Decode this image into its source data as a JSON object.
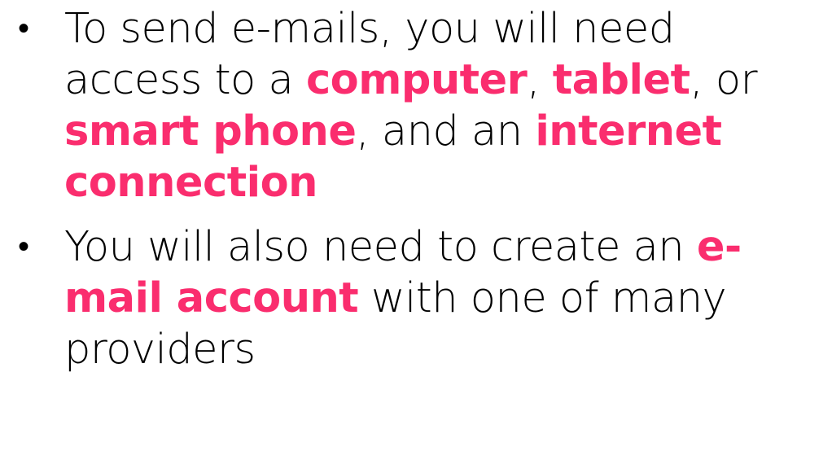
{
  "colors": {
    "text": "#000000",
    "accent": "#FA2D6E",
    "background": "#FFFFFF"
  },
  "bullets": [
    {
      "marker": "•",
      "segments": [
        {
          "text": "To send e-mails, you will need access to a ",
          "emphasis": false
        },
        {
          "text": "computer",
          "emphasis": true
        },
        {
          "text": ", ",
          "emphasis": false
        },
        {
          "text": "tablet",
          "emphasis": true
        },
        {
          "text": ", or ",
          "emphasis": false
        },
        {
          "text": "smart phone",
          "emphasis": true
        },
        {
          "text": ", and an ",
          "emphasis": false
        },
        {
          "text": "internet connection",
          "emphasis": true
        }
      ]
    },
    {
      "marker": "•",
      "segments": [
        {
          "text": "You will also need to create an ",
          "emphasis": false
        },
        {
          "text": "e-mail account",
          "emphasis": true
        },
        {
          "text": " with one of many providers",
          "emphasis": false
        }
      ]
    }
  ]
}
